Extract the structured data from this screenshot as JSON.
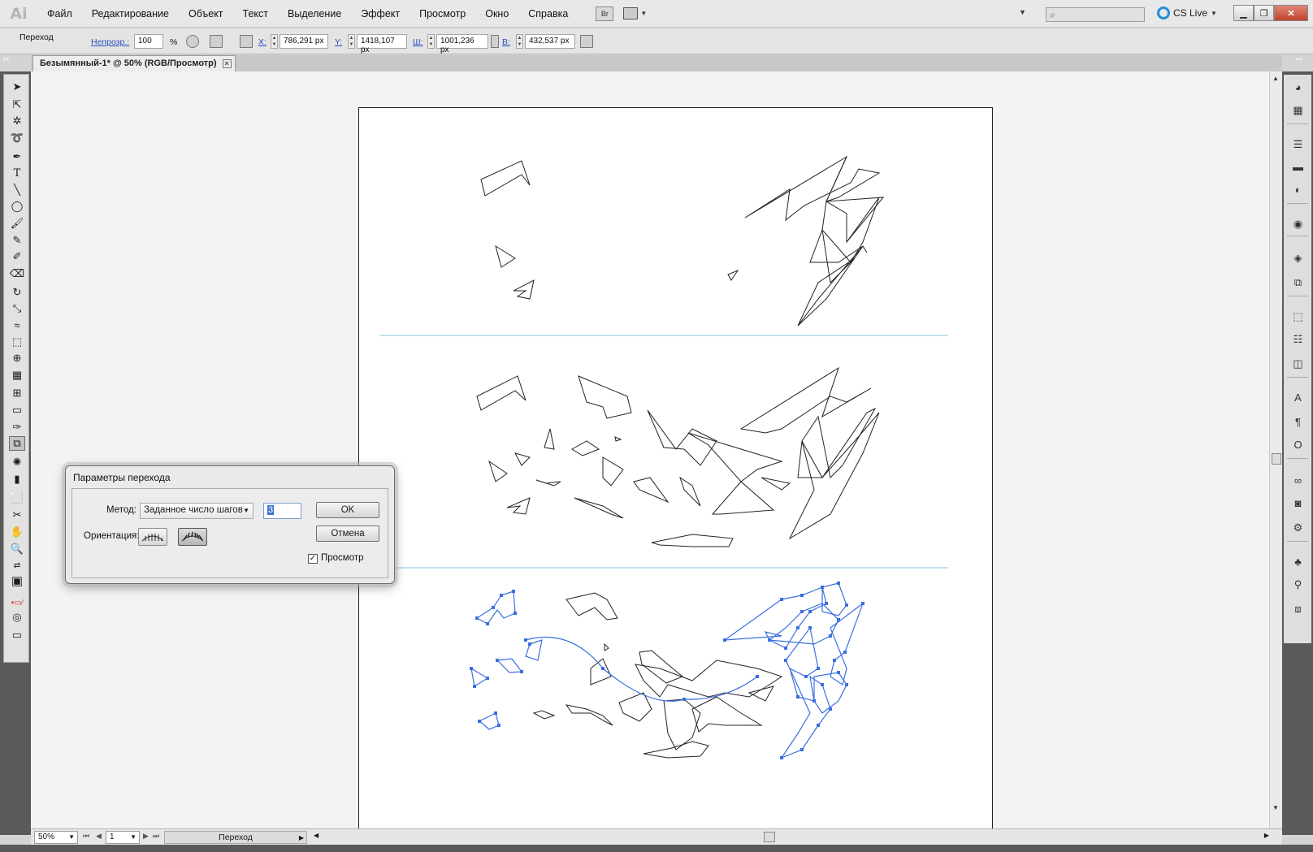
{
  "app": {
    "logo": "Ai",
    "menu": [
      "Файл",
      "Редактирование",
      "Объект",
      "Текст",
      "Выделение",
      "Эффект",
      "Просмотр",
      "Окно",
      "Справка"
    ],
    "bridge_label": "Br",
    "cslive_label": "CS Live",
    "window_buttons": [
      "minimize-icon",
      "restore-icon",
      "close-icon"
    ]
  },
  "control_bar": {
    "object_label": "Переход",
    "opacity_label": "Непрозр.:",
    "opacity_value": "100",
    "opacity_unit": "%",
    "x_label": "X:",
    "x_value": "786,291 px",
    "y_label": "Y:",
    "y_value": "1418,107 px",
    "w_label": "Ш:",
    "w_value": "1001,236 px",
    "h_label": "В:",
    "h_value": "432,537 px"
  },
  "document": {
    "tab_title": "Безымянный-1* @ 50% (RGB/Просмотр)"
  },
  "dialog": {
    "title": "Параметры перехода",
    "method_label": "Метод:",
    "method_value": "Заданное число шагов",
    "steps_value": "3",
    "orientation_label": "Ориентация:",
    "ok_label": "OK",
    "cancel_label": "Отмена",
    "preview_label": "Просмотр",
    "preview_checked": true,
    "orientation_selected": "align-to-path"
  },
  "status": {
    "zoom": "50%",
    "page": "1",
    "tool_status": "Переход"
  },
  "colors": {
    "selection": "#3b6fe0",
    "guide": "#7fc8ea"
  }
}
